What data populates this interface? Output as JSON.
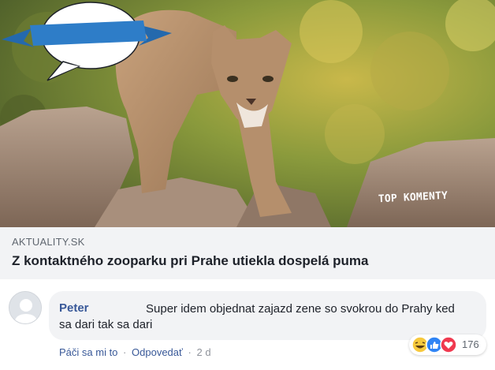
{
  "post": {
    "image": {
      "description_icon": "cougar-photo",
      "badge_label": "TOP KOMENTY",
      "badge_color": "#2e7dc8"
    },
    "link": {
      "source": "AKTUALITY.SK",
      "headline": "Z kontaktného zooparku pri Prahe utiekla dospelá puma"
    }
  },
  "comment": {
    "avatar_icon": "default-user-icon",
    "author": "Peter",
    "text": "Super idem objednat zajazd zene so svokrou do Prahy ked sa dari tak sa dari",
    "actions": {
      "like": "Páči sa mi to",
      "separator": "·",
      "reply": "Odpovedať",
      "time": "2 d"
    },
    "reactions": {
      "icons": [
        "haha-icon",
        "like-icon",
        "love-icon"
      ],
      "count": "176"
    }
  },
  "colors": {
    "link_blue": "#385898",
    "bubble_bg": "#f2f3f5",
    "meta_gray": "#606770"
  }
}
